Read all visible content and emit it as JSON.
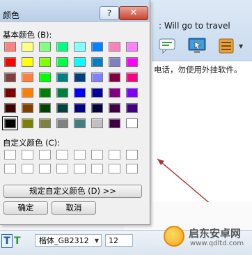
{
  "dialog": {
    "title": "颜色",
    "help_label": "?",
    "close_label": "✕",
    "basic_colors_label": "基本颜色 (B):",
    "custom_colors_label": "自定义颜色 (C):",
    "define_custom_label": "规定自定义颜色 (D) >>",
    "ok_label": "确定",
    "cancel_label": "取消",
    "selected_color": "#000000",
    "basic_colors": [
      [
        "#ff8080",
        "#ffff80",
        "#80ff80",
        "#00ff80",
        "#80ffff",
        "#0080ff",
        "#ff80c0",
        "#ff80ff"
      ],
      [
        "#ff0000",
        "#ffff00",
        "#80ff00",
        "#00ff40",
        "#00ffff",
        "#0080c0",
        "#8080c0",
        "#ff00ff"
      ],
      [
        "#804040",
        "#ff8040",
        "#00ff00",
        "#008080",
        "#004080",
        "#8080ff",
        "#800040",
        "#ff0080"
      ],
      [
        "#800000",
        "#ff8000",
        "#008000",
        "#008040",
        "#0000ff",
        "#0000a0",
        "#800080",
        "#8000ff"
      ],
      [
        "#400000",
        "#804000",
        "#004000",
        "#004040",
        "#000080",
        "#000040",
        "#400040",
        "#400080"
      ],
      [
        "#000000",
        "#808000",
        "#808040",
        "#808080",
        "#408080",
        "#c0c0c0",
        "#400040",
        "#ffffff"
      ]
    ]
  },
  "chat": {
    "title": ": Will go to travel",
    "notice": "电话，勿使用外挂软件。"
  },
  "toolbar": {
    "icons": [
      "message-icon",
      "remote-desktop-icon",
      "app-icon"
    ]
  },
  "format": {
    "font": "楷体_GB2312",
    "size": "12"
  },
  "watermark": {
    "name": "启东安卓网",
    "url": "www.qdltd.com"
  }
}
